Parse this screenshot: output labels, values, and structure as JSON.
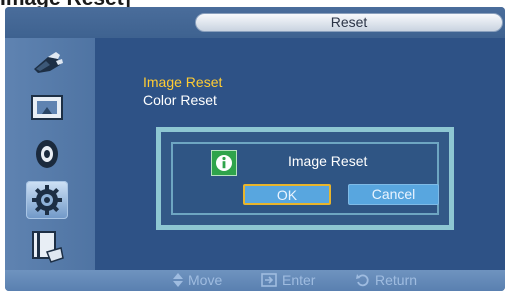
{
  "page_heading": "Image Reset]",
  "osd": {
    "title": "Reset",
    "sidebar": {
      "items": [
        {
          "icon": "input-source-icon",
          "active": false
        },
        {
          "icon": "picture-icon",
          "active": false
        },
        {
          "icon": "sound-icon",
          "active": false
        },
        {
          "icon": "setup-gear-icon",
          "active": true
        },
        {
          "icon": "multi-control-icon",
          "active": false
        }
      ]
    },
    "menu": {
      "items": [
        {
          "label": "Image Reset",
          "selected": true
        },
        {
          "label": "Color Reset",
          "selected": false
        }
      ]
    },
    "dialog": {
      "icon": "info-icon",
      "message": "Image Reset",
      "ok_label": "OK",
      "cancel_label": "Cancel"
    },
    "hints": {
      "move": "Move",
      "enter": "Enter",
      "return": "Return"
    }
  }
}
